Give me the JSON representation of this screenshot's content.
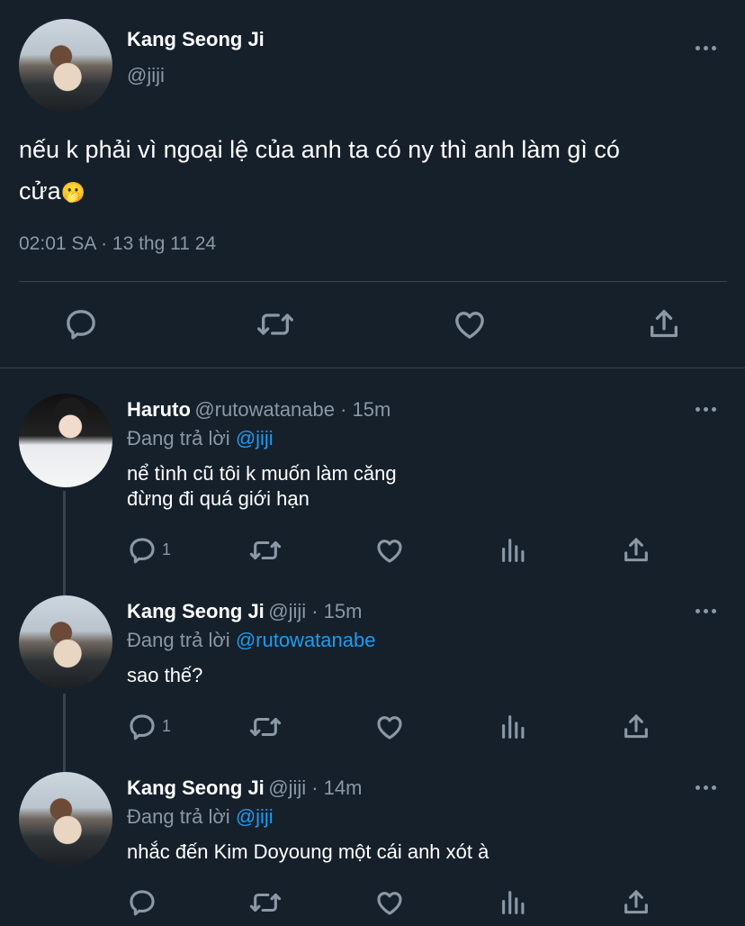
{
  "main_tweet": {
    "author_name": "Kang Seong Ji",
    "author_handle": "@jiji",
    "text": "nếu k phải vì ngoại lệ của anh ta có ny thì anh làm gì có cửa🫢",
    "text_line1": "nếu k phải vì ngoại lệ của anh ta có ny thì anh làm gì có",
    "text_line2": "cửa",
    "emoji": "🫢",
    "timestamp": "02:01 SA · 13 thg 11 24",
    "actions": [
      "reply-icon",
      "retweet-icon",
      "like-icon",
      "share-icon"
    ]
  },
  "replies": [
    {
      "author_name": "Haruto",
      "author_handle": "@rutowatanabe · 15m",
      "replying_label": "Đang trả lời ",
      "replying_to": "@jiji",
      "line1": "nể tình cũ tôi k muốn làm căng",
      "line2": "đừng đi quá giới hạn",
      "reply_count": "1"
    },
    {
      "author_name": "Kang Seong Ji",
      "author_handle": "@jiji · 15m",
      "replying_label": "Đang trả lời ",
      "replying_to": "@rutowatanabe",
      "line1": "sao thế?",
      "reply_count": "1"
    },
    {
      "author_name": "Kang Seong Ji",
      "author_handle": "@jiji · 14m",
      "replying_label": "Đang trả lời ",
      "replying_to": "@jiji",
      "line1": "nhắc đến Kim Doyoung một cái anh xót à",
      "reply_count": ""
    }
  ],
  "colors": {
    "background": "#15202b",
    "muted": "#8b98a5",
    "link": "#1d9bf0",
    "divider": "#38444d"
  }
}
